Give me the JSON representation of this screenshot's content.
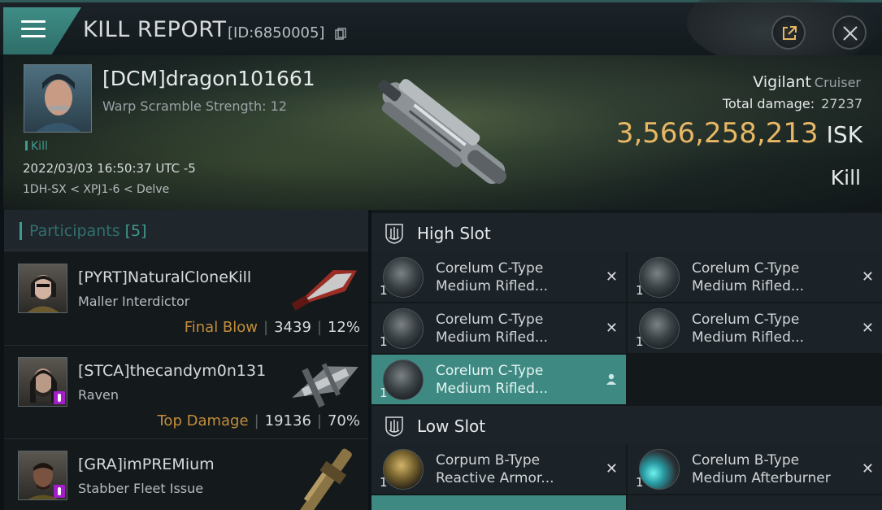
{
  "header": {
    "title": "KILL REPORT",
    "report_id": "[ID:6850005]"
  },
  "victim": {
    "name": "[DCM]dragon101661",
    "subtitle": "Warp Scramble Strength: 12",
    "kill_tag": "Kill",
    "datetime": "2022/03/03 16:50:37 UTC -5",
    "location": "1DH-SX < XPJ1-6 < Delve",
    "ship_name": "Vigilant",
    "ship_class": "Cruiser",
    "total_damage_label": "Total damage:",
    "total_damage": "27237",
    "isk_value": "3,566,258,213",
    "isk_unit": "ISK",
    "result": "Kill"
  },
  "participants": {
    "label": "Participants",
    "count": "[5]",
    "rows": [
      {
        "name": "[PYRT]NaturalCloneKill",
        "ship": "Maller Interdictor",
        "role": "Final Blow",
        "damage": "3439",
        "percent": "12%"
      },
      {
        "name": "[STCA]thecandym0n131",
        "ship": "Raven",
        "role": "Top Damage",
        "damage": "19136",
        "percent": "70%"
      },
      {
        "name": "[GRA]imPREMium",
        "ship": "Stabber Fleet Issue",
        "role": "",
        "damage": "",
        "percent": ""
      }
    ]
  },
  "slots": {
    "high": {
      "label": "High Slot",
      "items": [
        {
          "qty": "1",
          "line1": "Corelum C-Type",
          "line2": "Medium Rifled..."
        },
        {
          "qty": "1",
          "line1": "Corelum C-Type",
          "line2": "Medium Rifled..."
        },
        {
          "qty": "1",
          "line1": "Corelum C-Type",
          "line2": "Medium Rifled..."
        },
        {
          "qty": "1",
          "line1": "Corelum C-Type",
          "line2": "Medium Rifled..."
        },
        {
          "qty": "1",
          "line1": "Corelum C-Type",
          "line2": "Medium Rifled..."
        }
      ]
    },
    "low": {
      "label": "Low Slot",
      "items": [
        {
          "qty": "1",
          "line1": "Corpum B-Type",
          "line2": "Reactive Armor..."
        },
        {
          "qty": "1",
          "line1": "Corelum B-Type",
          "line2": "Medium Afterburner"
        }
      ]
    }
  },
  "colors": {
    "accent": "#3f9b8f",
    "isk": "#e7b764",
    "role": "#c28d3b",
    "highlight": "#3e8a83"
  },
  "icons": [
    "menu-icon",
    "copy-icon",
    "external-link-icon",
    "close-icon",
    "high-slot-icon",
    "low-slot-icon",
    "remove-icon",
    "person-icon",
    "module-icon"
  ]
}
